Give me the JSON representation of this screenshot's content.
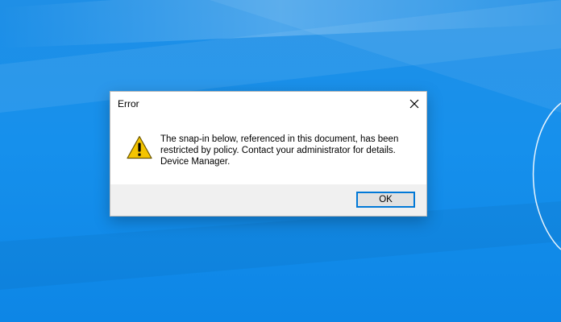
{
  "dialog": {
    "title": "Error",
    "message_lines": [
      "The snap-in below, referenced in this document, has been",
      "restricted by policy. Contact your administrator for details.",
      "Device Manager."
    ],
    "ok_label": "OK",
    "icon": "warning-icon",
    "close_icon": "close-icon"
  },
  "colors": {
    "desktop": "#1690ec",
    "dialog_bg": "#ffffff",
    "footer_bg": "#f0f0f0",
    "button_border": "#0078d7",
    "warning_yellow": "#f4c400"
  }
}
